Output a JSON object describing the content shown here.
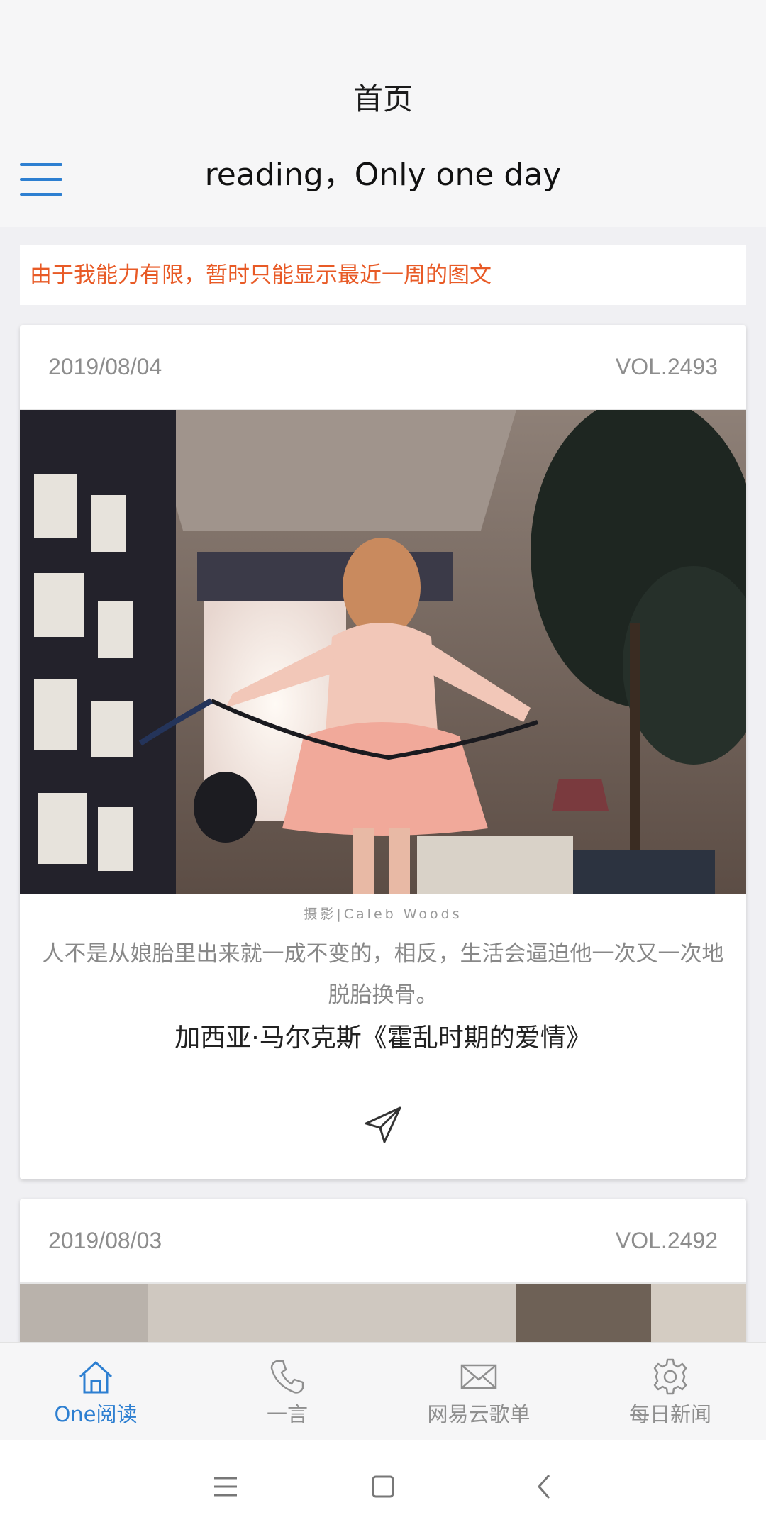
{
  "header": {
    "page_title": "首页",
    "toolbar_title": "reading，Only one day"
  },
  "notice": "由于我能力有限，暂时只能显示最近一周的图文",
  "colors": {
    "accent": "#2d7fd1",
    "notice_text": "#e85a26",
    "inactive": "#8f8f8f"
  },
  "cards": [
    {
      "date": "2019/08/04",
      "vol": "VOL.2493",
      "photo_credit": "摄影|Caleb Woods",
      "quote": "人不是从娘胎里出来就一成不变的，相反，生活会逼迫他一次又一次地脱胎换骨。",
      "source": "加西亚·马尔克斯《霍乱时期的爱情》",
      "share_icon": "paper-plane-icon"
    },
    {
      "date": "2019/08/03",
      "vol": "VOL.2492"
    }
  ],
  "bottom_nav": [
    {
      "label": "One阅读",
      "icon": "home-icon",
      "active": true
    },
    {
      "label": "一言",
      "icon": "phone-icon",
      "active": false
    },
    {
      "label": "网易云歌单",
      "icon": "mail-icon",
      "active": false
    },
    {
      "label": "每日新闻",
      "icon": "gear-icon",
      "active": false
    }
  ],
  "system_nav": {
    "menu_icon": "menu-icon",
    "home_icon": "square-icon",
    "back_icon": "back-icon"
  }
}
